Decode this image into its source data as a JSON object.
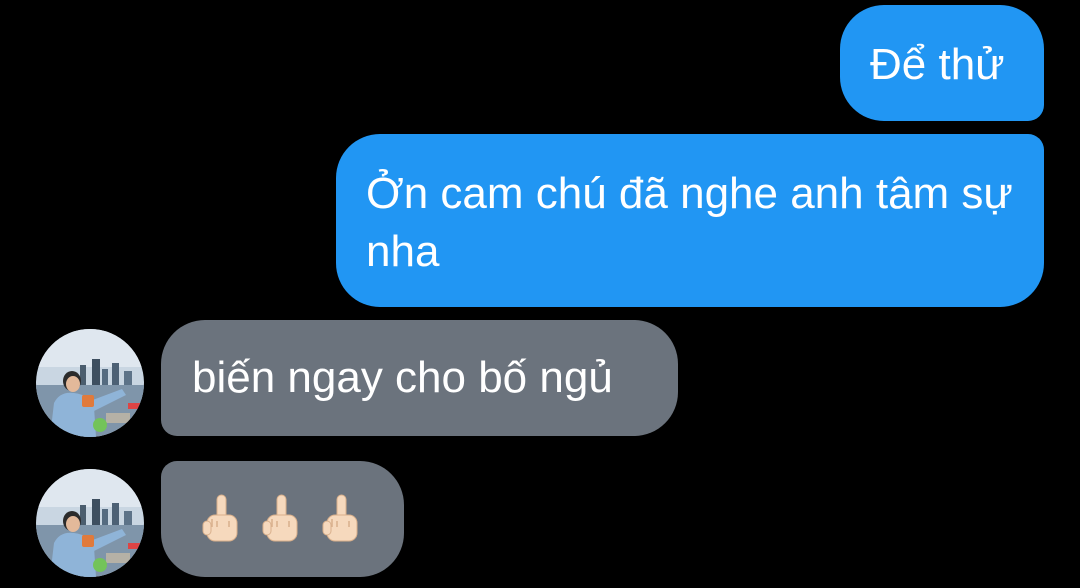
{
  "messages": [
    {
      "from": "me",
      "text": "Để thử"
    },
    {
      "from": "me",
      "text": "Ởn cam chú đã nghe anh tâm sự nha"
    },
    {
      "from": "them",
      "text": "biến ngay cho bố ngủ"
    },
    {
      "from": "them",
      "emoji": [
        "middle-finger-emoji",
        "middle-finger-emoji",
        "middle-finger-emoji"
      ]
    }
  ],
  "colors": {
    "background": "#000000",
    "outgoing_bubble": "#2196f3",
    "incoming_bubble": "#6b737d",
    "text": "#ffffff",
    "emoji_skin": "#f6d9bd"
  },
  "avatar": {
    "icon": "avatar-photo"
  }
}
